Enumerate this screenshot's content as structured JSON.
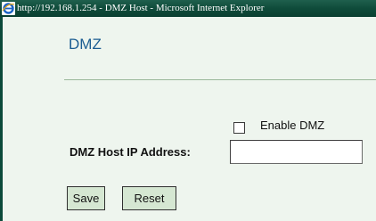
{
  "window": {
    "title": "http://192.168.1.254 - DMZ Host - Microsoft Internet Explorer",
    "icon": "ie-icon"
  },
  "page": {
    "title": "DMZ"
  },
  "form": {
    "enable_label": "Enable DMZ",
    "enable_checked": false,
    "ip_label": "DMZ Host IP Address:",
    "ip_value": "",
    "save_label": "Save",
    "reset_label": "Reset"
  },
  "colors": {
    "titlebar": "#0f4b3a",
    "page_background": "#eef5ee",
    "title_text": "#1c5d92",
    "button_background": "#d5e7d2"
  }
}
